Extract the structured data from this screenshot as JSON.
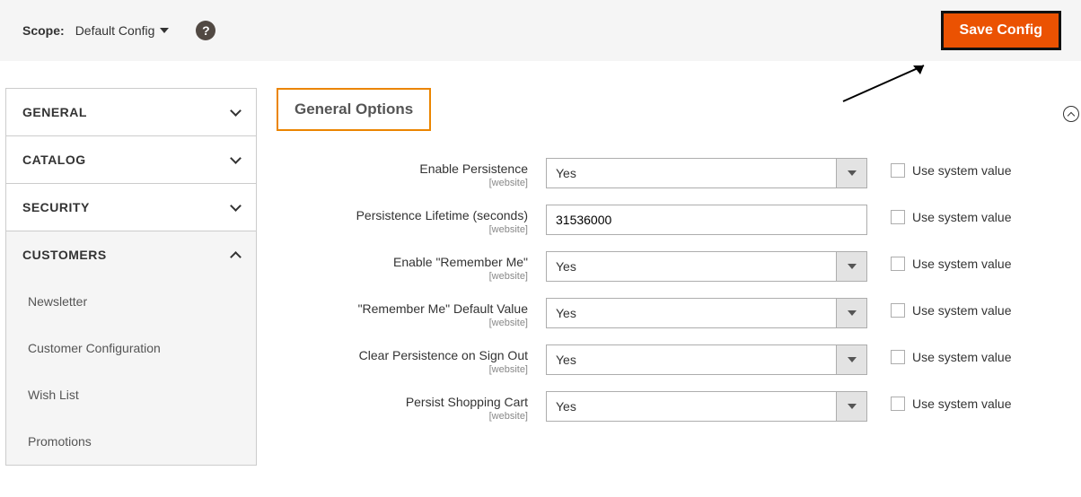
{
  "toolbar": {
    "scope_label": "Scope:",
    "scope_value": "Default Config",
    "save_button": "Save Config"
  },
  "sidebar": {
    "groups": [
      {
        "label": "GENERAL",
        "expanded": false
      },
      {
        "label": "CATALOG",
        "expanded": false
      },
      {
        "label": "SECURITY",
        "expanded": false
      },
      {
        "label": "CUSTOMERS",
        "expanded": true
      }
    ],
    "customers_items": [
      {
        "label": "Newsletter"
      },
      {
        "label": "Customer Configuration"
      },
      {
        "label": "Wish List"
      },
      {
        "label": "Promotions"
      }
    ]
  },
  "section": {
    "title": "General Options",
    "scope_tag": "[website]",
    "use_system_label": "Use system value",
    "fields": [
      {
        "label": "Enable Persistence",
        "type": "select",
        "value": "Yes"
      },
      {
        "label": "Persistence Lifetime (seconds)",
        "type": "text",
        "value": "31536000"
      },
      {
        "label": "Enable \"Remember Me\"",
        "type": "select",
        "value": "Yes"
      },
      {
        "label": "\"Remember Me\" Default Value",
        "type": "select",
        "value": "Yes"
      },
      {
        "label": "Clear Persistence on Sign Out",
        "type": "select",
        "value": "Yes"
      },
      {
        "label": "Persist Shopping Cart",
        "type": "select",
        "value": "Yes"
      }
    ]
  }
}
